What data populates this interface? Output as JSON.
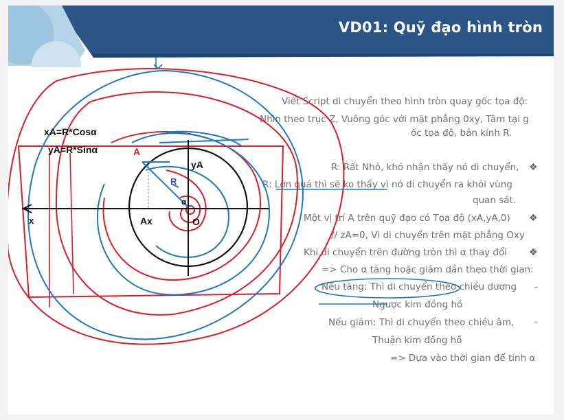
{
  "slide": {
    "title": "VD01: Quỹ đạo hình tròn",
    "lines": [
      "Viết Script di chuyển theo hình tròn quay gốc tọa độ:",
      "Nhìn theo trục Z, Vuông góc với mặt phẳng 0xy, Tâm tại g",
      "ốc tọa độ, bán kính R.",
      "R: Rất Nhỏ, khó nhận thấy nó di chuyển,",
      "R: Lớn quá thì sẽ ko thấy vì nó di chuyển ra khỏi vùng",
      "quan sát.",
      "Một vị trí A trên quỹ đạo có Tọa độ (xA,yA,0)",
      "// zA=0, Vì di chuyển trên mặt phẳng Oxy",
      "Khi di chuyển trên đường tròn thì α thay đổi",
      "=> Cho α tăng hoặc giảm dần theo thời gian:",
      "Nếu tăng: Thì di chuyển theo chiều dương",
      "Ngược kim đồng hồ",
      "Nếu giảm: Thì di chuyển theo chiều âm,",
      "Thuận kim đồng hồ",
      "=> Dựa vào thời gian để tính α"
    ]
  },
  "annotations": {
    "xa_formula": "xA=R*Cosα",
    "ya_formula": "yA=R*Sinα",
    "point_a": "A",
    "ya_label": "yA",
    "xa_label": "Ax",
    "origin_label": "O",
    "x_axis_label": "x",
    "radius_label": "R",
    "angle_label": "α"
  },
  "colors": {
    "header_blue": "#2b5584",
    "ink_red": "#d81e2a",
    "ink_blue": "#1f78c2",
    "text_gray": "#707070"
  }
}
